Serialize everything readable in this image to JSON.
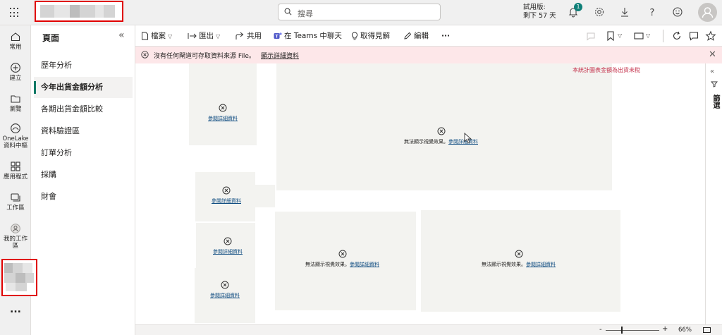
{
  "header": {
    "search_placeholder": "搜尋",
    "trial_line1": "試用版:",
    "trial_line2": "剩下 57 天",
    "notification_count": "1",
    "icons": [
      "waffle-icon",
      "search-icon",
      "bell-icon",
      "gear-icon",
      "download-icon",
      "help-icon",
      "smiley-icon",
      "avatar-icon"
    ]
  },
  "rail": {
    "items": [
      {
        "label": "常用",
        "icon": "home-icon"
      },
      {
        "label": "建立",
        "icon": "create-icon"
      },
      {
        "label": "瀏覽",
        "icon": "folder-icon"
      },
      {
        "label": "OneLake 資料中樞",
        "icon": "onelake-icon"
      },
      {
        "label": "應用程式",
        "icon": "apps-icon"
      },
      {
        "label": "工作區",
        "icon": "workspaces-icon"
      },
      {
        "label": "我的工作區",
        "icon": "my-workspace-icon"
      }
    ],
    "more": "..."
  },
  "pages": {
    "title": "頁面",
    "collapse": "«",
    "items": [
      "歷年分析",
      "今年出貨金額分析",
      "各期出貨金額比較",
      "資料驗證區",
      "訂單分析",
      "採購",
      "財會"
    ],
    "active_index": 1
  },
  "toolbar": {
    "file": "檔案",
    "export": "匯出",
    "share": "共用",
    "teams": "在 Teams 中聊天",
    "insights": "取得見解",
    "edit": "編輯",
    "more": "···"
  },
  "banner": {
    "message": "沒有任何閘道可存取資料來源 File。",
    "link": "顯示詳細資料",
    "close": "✕"
  },
  "canvas": {
    "note": "本統計圖表金額為出貨未稅",
    "error_short": "參閱詳細資料",
    "error_long_prefix": "無法顯示視覺效果。",
    "error_long_link": "參閱詳細資料"
  },
  "filters": {
    "arrow": "«",
    "label": "篩選"
  },
  "status": {
    "zoom": "66%",
    "zoom_level": 0.3,
    "minus": "-",
    "plus": "+"
  },
  "colors": {
    "accent": "#117865",
    "banner_bg": "#fde7e9",
    "note": "#c4314b",
    "highlight": "#e00000"
  }
}
